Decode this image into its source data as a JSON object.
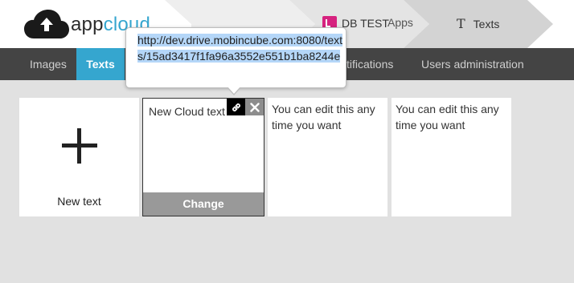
{
  "header": {
    "logo_text_main": "app",
    "logo_text_accent": "cloud",
    "breadcrumbs": {
      "apps_label": "Apps",
      "db_label": "DB TEST",
      "texts_label": "Texts",
      "texts_glyph": "T"
    }
  },
  "nav": {
    "items": [
      {
        "label": "Images",
        "active": false
      },
      {
        "label": "Texts",
        "active": true
      },
      {
        "label": "tifications",
        "active": false
      },
      {
        "label": "Users administration",
        "active": false
      }
    ]
  },
  "cards": {
    "new_card_label": "New text",
    "edit_card": {
      "text": "New Cloud text",
      "action_label": "Change"
    },
    "text_cards": [
      {
        "text": "You can edit this any time you want"
      },
      {
        "text": "You can edit this any time you want"
      }
    ]
  },
  "popover": {
    "url": "http://dev.drive.mobincube.com:8080/texts/15ad3417f1fa96a3552e551b1ba8244e"
  },
  "colors": {
    "accent": "#35a6cf",
    "nav_bg": "#444444",
    "db_icon": "#d6227f",
    "change_bar": "#999999",
    "selection": "#b4d6f8"
  },
  "icons": {
    "logo": "cloud-upload-icon",
    "db": "db-icon",
    "texts": "text-t-icon",
    "new": "plus-icon",
    "link": "link-icon",
    "close": "close-icon"
  }
}
